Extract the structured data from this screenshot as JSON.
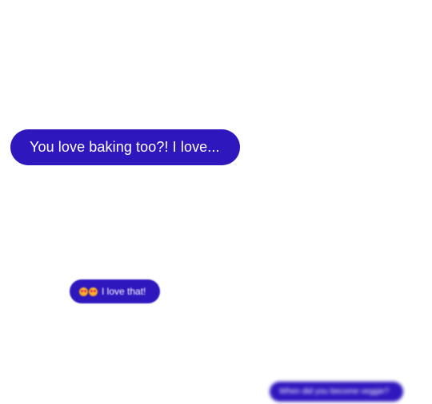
{
  "messages": [
    {
      "text": "You love baking too?! I love...",
      "bubble_color": "#2f17be",
      "text_color": "#ffffff"
    },
    {
      "emoji": [
        "heart-eyes-emoji",
        "heart-eyes-emoji"
      ],
      "text": "I love that!",
      "bubble_color": "#2f17be",
      "text_color": "#ffffff"
    },
    {
      "text": "When did you become veggie?",
      "bubble_color": "#2f17be",
      "text_color": "#ffffff"
    }
  ]
}
